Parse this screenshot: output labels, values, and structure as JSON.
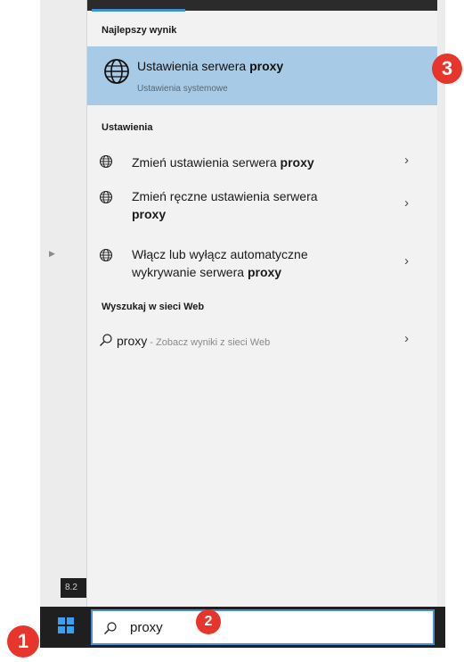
{
  "panel": {
    "best_match_header": "Najlepszy wynik",
    "best_match": {
      "title_prefix": "Ustawienia serwera ",
      "title_bold": "proxy",
      "subtitle": "Ustawienia systemowe",
      "icon": "globe-icon"
    },
    "settings_header": "Ustawienia",
    "settings_items": [
      {
        "line1": "Zmień ustawienia serwera ",
        "bold": "proxy",
        "line2": "",
        "line2_bold": ""
      },
      {
        "line1": "Zmień ręczne ustawienia serwera",
        "bold": "",
        "line2": "",
        "line2_bold": "proxy"
      },
      {
        "line1": "Włącz lub wyłącz automatyczne",
        "bold": "",
        "line2": "wykrywanie serwera ",
        "line2_bold": "proxy"
      }
    ],
    "web_header": "Wyszukaj w sieci Web",
    "web_item": {
      "query": "proxy",
      "suffix": " - Zobacz wyniki z sieci Web"
    },
    "chevron": "›"
  },
  "taskbar": {
    "search_value": "proxy",
    "clock_tooltip": "8.2"
  },
  "badges": {
    "one": "1",
    "two": "2",
    "three": "3"
  },
  "colors": {
    "best_match_bg": "#a7cbe6",
    "badge": "#e8352b",
    "taskbar": "#1f1f1f",
    "windows_logo": "#3aa0f3"
  }
}
